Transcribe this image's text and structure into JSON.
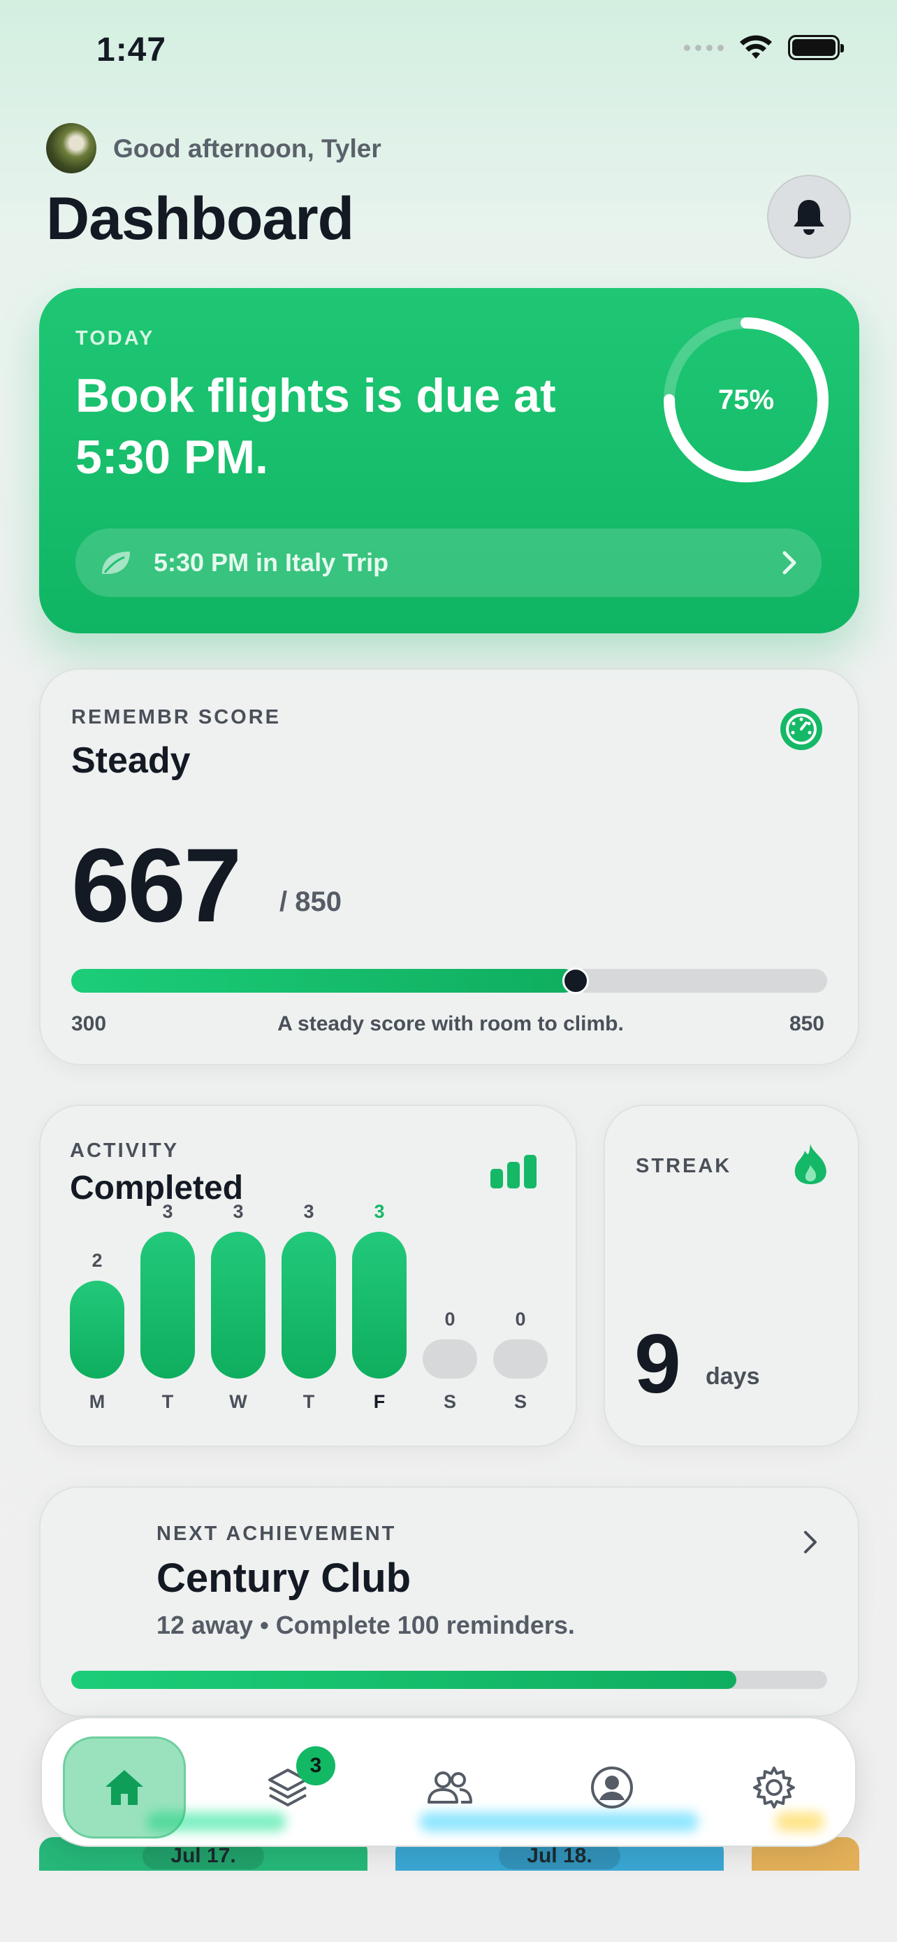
{
  "status_bar": {
    "time": "1:47"
  },
  "header": {
    "greeting": "Good afternoon, Tyler",
    "title": "Dashboard"
  },
  "today_card": {
    "eyebrow": "TODAY",
    "title": "Book flights is due at 5:30 PM.",
    "progress_percent": 75,
    "progress_label": "75%",
    "link_text": "5:30 PM in Italy Trip"
  },
  "score_card": {
    "eyebrow": "REMEMBR SCORE",
    "status": "Steady",
    "value": "667",
    "max_text": "/ 850",
    "score": 667,
    "min": 300,
    "max": 850,
    "min_label": "300",
    "max_label": "850",
    "caption": "A steady score with room to climb."
  },
  "activity_card": {
    "eyebrow": "ACTIVITY",
    "title": "Completed",
    "days": [
      {
        "day": "M",
        "count": 2
      },
      {
        "day": "T",
        "count": 3
      },
      {
        "day": "W",
        "count": 3
      },
      {
        "day": "T",
        "count": 3
      },
      {
        "day": "F",
        "count": 3,
        "today": true
      },
      {
        "day": "S",
        "count": 0
      },
      {
        "day": "S",
        "count": 0
      }
    ]
  },
  "streak_card": {
    "eyebrow": "STREAK",
    "value": "9",
    "unit": "days"
  },
  "achievement_card": {
    "eyebrow": "NEXT ACHIEVEMENT",
    "title": "Century Club",
    "description": "12 away • Complete 100 reminders.",
    "progress": 0.88
  },
  "calendar_peek": {
    "dates": [
      "Jul 17.",
      "Jul 18."
    ]
  },
  "tab_bar": {
    "tabs": [
      {
        "name": "home",
        "icon": "home-icon",
        "active": true
      },
      {
        "name": "lists",
        "icon": "stack-icon",
        "badge": "3"
      },
      {
        "name": "people",
        "icon": "people-icon"
      },
      {
        "name": "profile",
        "icon": "profile-icon"
      },
      {
        "name": "settings",
        "icon": "gear-icon"
      }
    ]
  },
  "colors": {
    "accent": "#15b866",
    "today_card": "#1cc16f",
    "text_dark": "#141a24"
  }
}
